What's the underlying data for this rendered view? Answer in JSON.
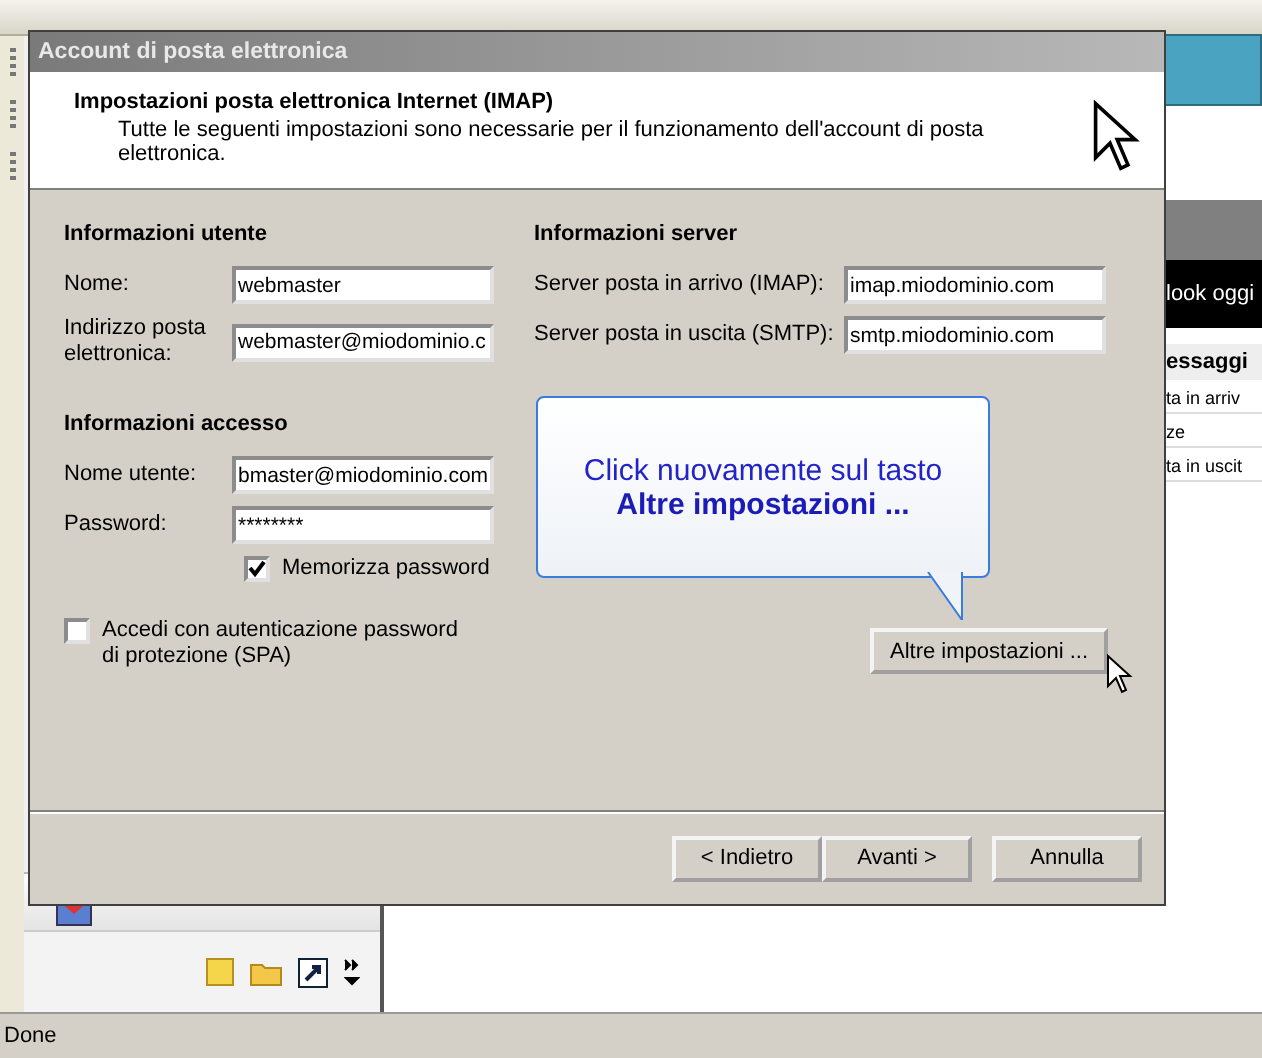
{
  "window": {
    "title": "Account di posta elettronica"
  },
  "header": {
    "title": "Impostazioni posta elettronica Internet (IMAP)",
    "description": "Tutte le seguenti impostazioni sono necessarie per il funzionamento dell'account di posta elettronica."
  },
  "user_info": {
    "heading": "Informazioni utente",
    "fields": [
      {
        "label": "Nome:",
        "value": "webmaster"
      },
      {
        "label": "Indirizzo posta elettronica:",
        "value": "webmaster@miodominio.c"
      }
    ]
  },
  "access_info": {
    "heading": "Informazioni accesso",
    "fields": [
      {
        "label": "Nome utente:",
        "value": "bmaster@miodominio.com"
      },
      {
        "label": "Password:",
        "value": "********"
      }
    ],
    "remember": {
      "label": "Memorizza password",
      "checked": true
    },
    "spa": {
      "label": "Accedi con autenticazione password di protezione (SPA)",
      "checked": false
    }
  },
  "server_info": {
    "heading": "Informazioni server",
    "fields": [
      {
        "label": "Server posta in arrivo (IMAP):",
        "value": "imap.miodominio.com"
      },
      {
        "label": "Server posta in uscita (SMTP):",
        "value": "smtp.miodominio.com"
      }
    ]
  },
  "callout": {
    "line": "Click nuovamente sul tasto",
    "emphasis": "Altre impostazioni ..."
  },
  "more_settings_button": "Altre impostazioni ...",
  "buttons": [
    "< Indietro",
    "Avanti >",
    "Annulla"
  ],
  "background": {
    "banner": "look oggi",
    "section": "essaggi",
    "items": [
      "ta in arriv",
      "ze",
      "ta in uscit"
    ]
  },
  "status_bar": "Done"
}
